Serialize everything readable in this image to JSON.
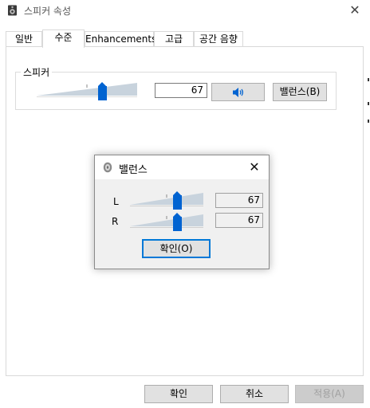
{
  "window": {
    "title": "스피커 속성",
    "close_glyph": "✕"
  },
  "tabs": [
    {
      "label": "일반",
      "active": false
    },
    {
      "label": "수준",
      "active": true
    },
    {
      "label": "Enhancements",
      "active": false
    },
    {
      "label": "고급",
      "active": false
    },
    {
      "label": "공간 음향",
      "active": false
    }
  ],
  "levels": {
    "group_label": "스피커",
    "volume": "67",
    "volume_fraction": 0.67,
    "mute_icon": "speaker-icon",
    "balance_label": "밸런스(B)"
  },
  "balance_dialog": {
    "title": "밸런스",
    "close_glyph": "✕",
    "channels": [
      {
        "label": "L",
        "value": "67",
        "fraction": 0.67
      },
      {
        "label": "R",
        "value": "67",
        "fraction": 0.67
      }
    ],
    "ok_label": "확인(O)"
  },
  "footer": {
    "ok_label": "확인",
    "cancel_label": "취소",
    "apply_label": "적용(A)",
    "apply_enabled": false
  },
  "colors": {
    "accent": "#0063d1",
    "focus_border": "#0078d7",
    "button_face": "#e1e1e1",
    "dialog_bg": "#f0f0f0",
    "track": "#c8d3dd"
  }
}
